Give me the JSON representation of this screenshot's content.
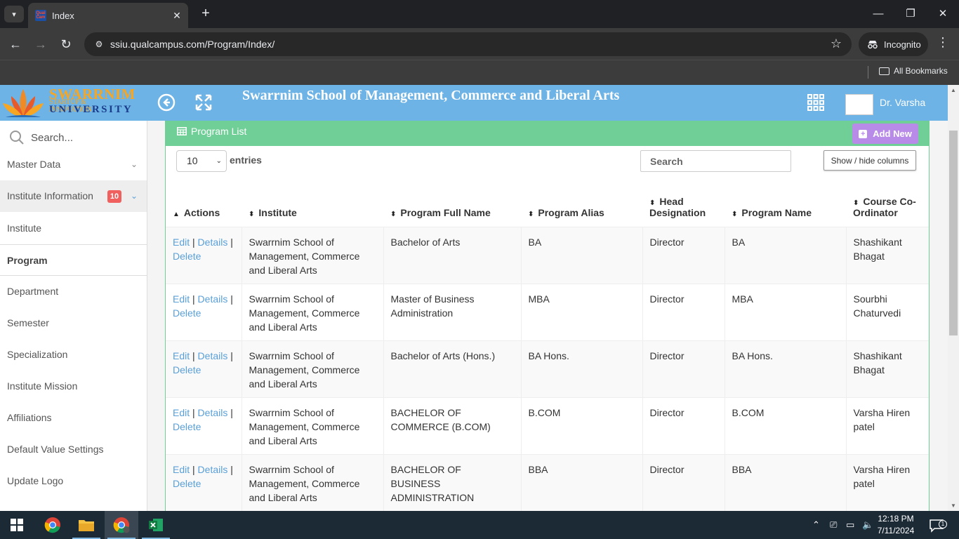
{
  "browser": {
    "tab_title": "Index",
    "url": "ssiu.qualcampus.com/Program/Index/",
    "incognito_label": "Incognito",
    "all_bookmarks": "All Bookmarks"
  },
  "header": {
    "logo_line1": "SWARRNIM",
    "logo_line2": "STARTUP & INNOVATION",
    "logo_line3": "UNIVERSITY",
    "title": "Swarrnim School of Management, Commerce and Liberal Arts",
    "user_name": "Dr. Varsha"
  },
  "sidebar": {
    "search_placeholder": "Search...",
    "items": [
      {
        "label": "Master Data"
      },
      {
        "label": "Institute Information",
        "badge": "10"
      },
      {
        "label": "Institute"
      },
      {
        "label": "Program"
      },
      {
        "label": "Department"
      },
      {
        "label": "Semester"
      },
      {
        "label": "Specialization"
      },
      {
        "label": "Institute Mission"
      },
      {
        "label": "Affiliations"
      },
      {
        "label": "Default Value Settings"
      },
      {
        "label": "Update Logo"
      }
    ]
  },
  "panel": {
    "title": "Program List",
    "add_new": "Add New",
    "entries_value": "10",
    "entries_label": "entries",
    "search_placeholder": "Search",
    "show_hide": "Show / hide columns"
  },
  "table": {
    "columns": [
      "Actions",
      "Institute",
      "Program Full Name",
      "Program Alias",
      "Head Designation",
      "Program Name",
      "Course Co-Ordinator"
    ],
    "action_edit": "Edit",
    "action_details": "Details",
    "action_delete": "Delete",
    "rows": [
      {
        "institute": "Swarrnim School of Management, Commerce and Liberal Arts",
        "full_name": "Bachelor of Arts",
        "alias": "BA",
        "head": "Director",
        "name": "BA",
        "coordinator": "Shashikant Bhagat"
      },
      {
        "institute": "Swarrnim School of Management, Commerce and Liberal Arts",
        "full_name": "Master of Business Administration",
        "alias": "MBA",
        "head": "Director",
        "name": "MBA",
        "coordinator": "Sourbhi Chaturvedi"
      },
      {
        "institute": "Swarrnim School of Management, Commerce and Liberal Arts",
        "full_name": "Bachelor of Arts (Hons.)",
        "alias": "BA Hons.",
        "head": "Director",
        "name": "BA Hons.",
        "coordinator": "Shashikant Bhagat"
      },
      {
        "institute": "Swarrnim School of Management, Commerce and Liberal Arts",
        "full_name": "BACHELOR OF COMMERCE (B.COM)",
        "alias": "B.COM",
        "head": "Director",
        "name": "B.COM",
        "coordinator": "Varsha Hiren patel"
      },
      {
        "institute": "Swarrnim School of Management, Commerce and Liberal Arts",
        "full_name": "BACHELOR OF BUSINESS ADMINISTRATION",
        "alias": "BBA",
        "head": "Director",
        "name": "BBA",
        "coordinator": "Varsha Hiren patel"
      }
    ]
  },
  "taskbar": {
    "time": "12:18 PM",
    "date": "7/11/2024",
    "notification_count": "1"
  },
  "colors": {
    "header_bg": "#6db3e5",
    "panel_green": "#6fcf97",
    "add_new_purple": "#b98be9",
    "link_blue": "#5aa0d8",
    "badge_red": "#f0605f"
  }
}
